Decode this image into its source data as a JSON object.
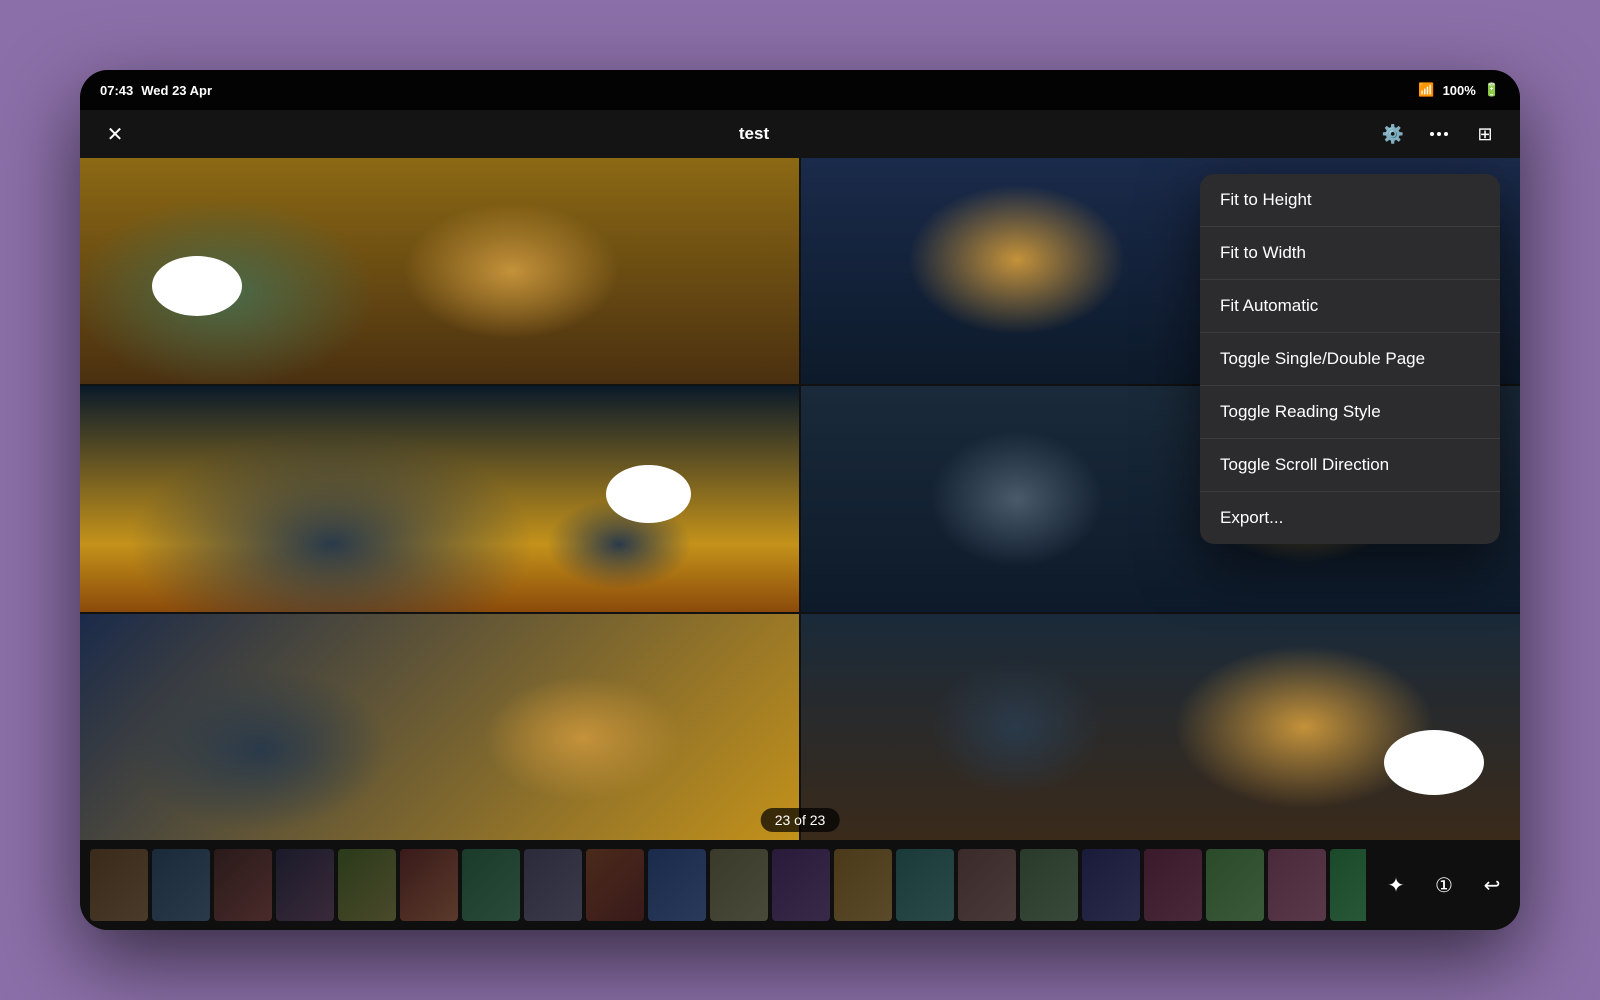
{
  "device": {
    "time": "07:43",
    "date": "Wed 23 Apr",
    "battery_pct": "100%",
    "wifi": true
  },
  "app": {
    "title": "test",
    "close_label": "✕",
    "page_indicator": "23 of 23"
  },
  "context_menu": {
    "items": [
      {
        "id": "fit-to-height",
        "label": "Fit to Height"
      },
      {
        "id": "fit-to-width",
        "label": "Fit to Width"
      },
      {
        "id": "fit-automatic",
        "label": "Fit Automatic"
      },
      {
        "id": "toggle-single-double",
        "label": "Toggle Single/Double Page"
      },
      {
        "id": "toggle-reading-style",
        "label": "Toggle Reading Style"
      },
      {
        "id": "toggle-scroll-direction",
        "label": "Toggle Scroll Direction"
      },
      {
        "id": "export",
        "label": "Export..."
      }
    ]
  },
  "toolbar": {
    "gear_icon": "⚙",
    "more_icon": "•••",
    "grid_icon": "⊞",
    "sparkle_icon": "✦",
    "page_num_icon": "①",
    "back_icon": "⊕"
  },
  "thumbnails": {
    "count": 23,
    "active_index": 22
  }
}
